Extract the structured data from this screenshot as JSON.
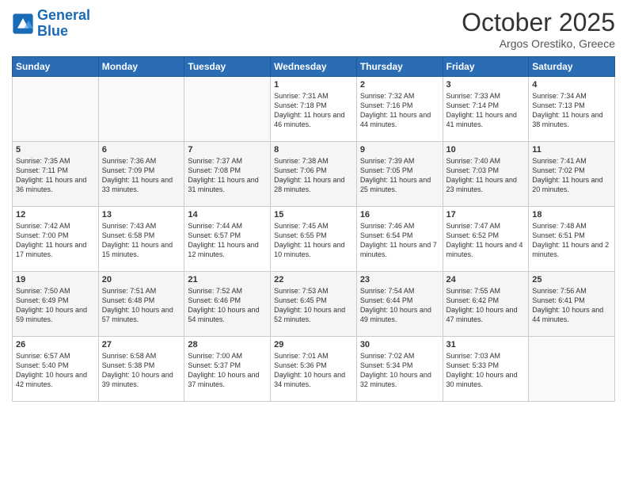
{
  "logo": {
    "text_general": "General",
    "text_blue": "Blue"
  },
  "title": "October 2025",
  "subtitle": "Argos Orestiko, Greece",
  "days_of_week": [
    "Sunday",
    "Monday",
    "Tuesday",
    "Wednesday",
    "Thursday",
    "Friday",
    "Saturday"
  ],
  "weeks": [
    [
      {
        "day": "",
        "empty": true
      },
      {
        "day": "",
        "empty": true
      },
      {
        "day": "",
        "empty": true
      },
      {
        "day": "1",
        "sunrise": "7:31 AM",
        "sunset": "7:18 PM",
        "daylight": "11 hours and 46 minutes."
      },
      {
        "day": "2",
        "sunrise": "7:32 AM",
        "sunset": "7:16 PM",
        "daylight": "11 hours and 44 minutes."
      },
      {
        "day": "3",
        "sunrise": "7:33 AM",
        "sunset": "7:14 PM",
        "daylight": "11 hours and 41 minutes."
      },
      {
        "day": "4",
        "sunrise": "7:34 AM",
        "sunset": "7:13 PM",
        "daylight": "11 hours and 38 minutes."
      }
    ],
    [
      {
        "day": "5",
        "sunrise": "7:35 AM",
        "sunset": "7:11 PM",
        "daylight": "11 hours and 36 minutes."
      },
      {
        "day": "6",
        "sunrise": "7:36 AM",
        "sunset": "7:09 PM",
        "daylight": "11 hours and 33 minutes."
      },
      {
        "day": "7",
        "sunrise": "7:37 AM",
        "sunset": "7:08 PM",
        "daylight": "11 hours and 31 minutes."
      },
      {
        "day": "8",
        "sunrise": "7:38 AM",
        "sunset": "7:06 PM",
        "daylight": "11 hours and 28 minutes."
      },
      {
        "day": "9",
        "sunrise": "7:39 AM",
        "sunset": "7:05 PM",
        "daylight": "11 hours and 25 minutes."
      },
      {
        "day": "10",
        "sunrise": "7:40 AM",
        "sunset": "7:03 PM",
        "daylight": "11 hours and 23 minutes."
      },
      {
        "day": "11",
        "sunrise": "7:41 AM",
        "sunset": "7:02 PM",
        "daylight": "11 hours and 20 minutes."
      }
    ],
    [
      {
        "day": "12",
        "sunrise": "7:42 AM",
        "sunset": "7:00 PM",
        "daylight": "11 hours and 17 minutes."
      },
      {
        "day": "13",
        "sunrise": "7:43 AM",
        "sunset": "6:58 PM",
        "daylight": "11 hours and 15 minutes."
      },
      {
        "day": "14",
        "sunrise": "7:44 AM",
        "sunset": "6:57 PM",
        "daylight": "11 hours and 12 minutes."
      },
      {
        "day": "15",
        "sunrise": "7:45 AM",
        "sunset": "6:55 PM",
        "daylight": "11 hours and 10 minutes."
      },
      {
        "day": "16",
        "sunrise": "7:46 AM",
        "sunset": "6:54 PM",
        "daylight": "11 hours and 7 minutes."
      },
      {
        "day": "17",
        "sunrise": "7:47 AM",
        "sunset": "6:52 PM",
        "daylight": "11 hours and 4 minutes."
      },
      {
        "day": "18",
        "sunrise": "7:48 AM",
        "sunset": "6:51 PM",
        "daylight": "11 hours and 2 minutes."
      }
    ],
    [
      {
        "day": "19",
        "sunrise": "7:50 AM",
        "sunset": "6:49 PM",
        "daylight": "10 hours and 59 minutes."
      },
      {
        "day": "20",
        "sunrise": "7:51 AM",
        "sunset": "6:48 PM",
        "daylight": "10 hours and 57 minutes."
      },
      {
        "day": "21",
        "sunrise": "7:52 AM",
        "sunset": "6:46 PM",
        "daylight": "10 hours and 54 minutes."
      },
      {
        "day": "22",
        "sunrise": "7:53 AM",
        "sunset": "6:45 PM",
        "daylight": "10 hours and 52 minutes."
      },
      {
        "day": "23",
        "sunrise": "7:54 AM",
        "sunset": "6:44 PM",
        "daylight": "10 hours and 49 minutes."
      },
      {
        "day": "24",
        "sunrise": "7:55 AM",
        "sunset": "6:42 PM",
        "daylight": "10 hours and 47 minutes."
      },
      {
        "day": "25",
        "sunrise": "7:56 AM",
        "sunset": "6:41 PM",
        "daylight": "10 hours and 44 minutes."
      }
    ],
    [
      {
        "day": "26",
        "sunrise": "6:57 AM",
        "sunset": "5:40 PM",
        "daylight": "10 hours and 42 minutes."
      },
      {
        "day": "27",
        "sunrise": "6:58 AM",
        "sunset": "5:38 PM",
        "daylight": "10 hours and 39 minutes."
      },
      {
        "day": "28",
        "sunrise": "7:00 AM",
        "sunset": "5:37 PM",
        "daylight": "10 hours and 37 minutes."
      },
      {
        "day": "29",
        "sunrise": "7:01 AM",
        "sunset": "5:36 PM",
        "daylight": "10 hours and 34 minutes."
      },
      {
        "day": "30",
        "sunrise": "7:02 AM",
        "sunset": "5:34 PM",
        "daylight": "10 hours and 32 minutes."
      },
      {
        "day": "31",
        "sunrise": "7:03 AM",
        "sunset": "5:33 PM",
        "daylight": "10 hours and 30 minutes."
      },
      {
        "day": "",
        "empty": true
      }
    ]
  ]
}
